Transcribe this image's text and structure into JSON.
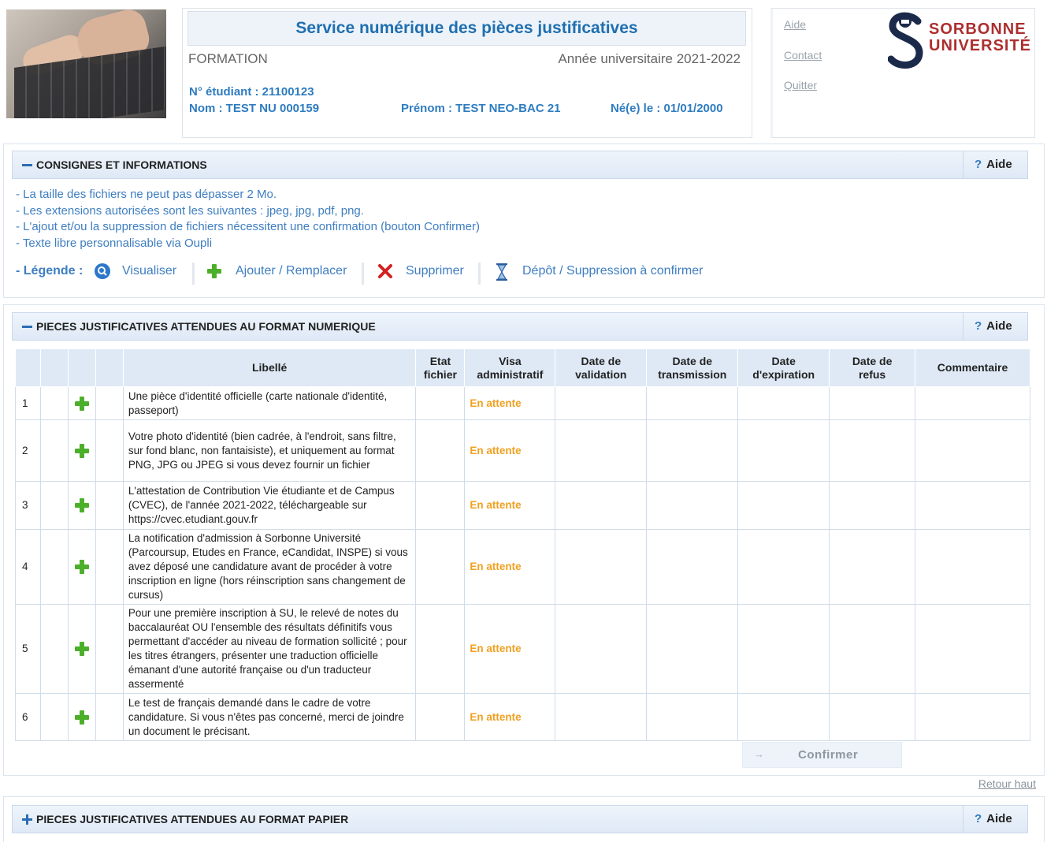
{
  "header": {
    "title": "Service numérique des pièces justificatives",
    "formation": "FORMATION",
    "annee": "Année universitaire 2021-2022",
    "num_etudiant": "N° étudiant : 21100123",
    "nom": "Nom : TEST NU 000159",
    "prenom": "Prénom : TEST NEO-BAC 21",
    "naissance": "Né(e) le : 01/01/2000"
  },
  "nav": {
    "aide": "Aide",
    "contact": "Contact",
    "quitter": "Quitter",
    "logo_line1": "SORBONNE",
    "logo_line2": "UNIVERSITÉ"
  },
  "consignes": {
    "title": "CONSIGNES ET INFORMATIONS",
    "aide": "Aide",
    "lines": [
      "- La taille des fichiers ne peut pas dépasser 2 Mo.",
      "- Les extensions autorisées sont les suivantes : jpeg, jpg, pdf, png.",
      "- L'ajout et/ou la suppression de fichiers nécessitent une confirmation (bouton Confirmer)",
      "- Texte libre personnalisable via Oupli"
    ],
    "legend_label": "- Légende :",
    "legend_visualiser": "Visualiser",
    "legend_ajouter": "Ajouter / Remplacer",
    "legend_supprimer": "Supprimer",
    "legend_depot": "Dépôt / Suppression à confirmer"
  },
  "numerique": {
    "title": "PIECES JUSTIFICATIVES ATTENDUES AU FORMAT NUMERIQUE",
    "aide": "Aide",
    "columns": {
      "libelle": "Libellé",
      "etat_1": "Etat",
      "etat_2": "fichier",
      "visa_1": "Visa",
      "visa_2": "administratif",
      "validation_1": "Date de",
      "validation_2": "validation",
      "transmission_1": "Date de",
      "transmission_2": "transmission",
      "expiration_1": "Date",
      "expiration_2": "d'expiration",
      "refus_1": "Date de",
      "refus_2": "refus",
      "commentaire": "Commentaire"
    },
    "rows": [
      {
        "num": "1",
        "libelle": "Une pièce d'identité officielle (carte nationale d'identité, passeport)",
        "visa": "En attente"
      },
      {
        "num": "2",
        "libelle": "Votre photo d'identité (bien cadrée, à l'endroit, sans filtre, sur fond blanc, non fantaisiste), et uniquement au format PNG, JPG ou JPEG si vous devez fournir un fichier",
        "visa": "En attente"
      },
      {
        "num": "3",
        "libelle": "L'attestation de Contribution Vie étudiante et de Campus (CVEC), de l'année 2021-2022, téléchargeable sur https://cvec.etudiant.gouv.fr",
        "visa": "En attente"
      },
      {
        "num": "4",
        "libelle": "La notification d'admission à Sorbonne Université (Parcoursup, Etudes en France, eCandidat, INSPE) si vous avez déposé une candidature avant de procéder à votre inscription en ligne (hors réinscription sans changement de cursus)",
        "visa": "En attente"
      },
      {
        "num": "5",
        "libelle": "Pour une première inscription à SU, le relevé de notes du baccalauréat OU l'ensemble des résultats définitifs vous permettant d'accéder au niveau de formation sollicité ; pour les titres étrangers, présenter une traduction officielle émanant d'une autorité française ou d'un traducteur assermenté",
        "visa": "En attente"
      },
      {
        "num": "6",
        "libelle": "Le test de français demandé dans le cadre de votre candidature. Si vous n'êtes pas concerné, merci de joindre un document le précisant.",
        "visa": "En attente"
      }
    ],
    "confirmer": "Confirmer",
    "retour_haut": "Retour haut"
  },
  "papier": {
    "title": "PIECES JUSTIFICATIVES ATTENDUES AU FORMAT PAPIER",
    "aide": "Aide"
  },
  "colors": {
    "accent": "#2e7cc0",
    "title_blue": "#1f6fb0",
    "attente": "#f0a020",
    "logo_red": "#ad2f2f",
    "add_green": "#4caf2a"
  }
}
